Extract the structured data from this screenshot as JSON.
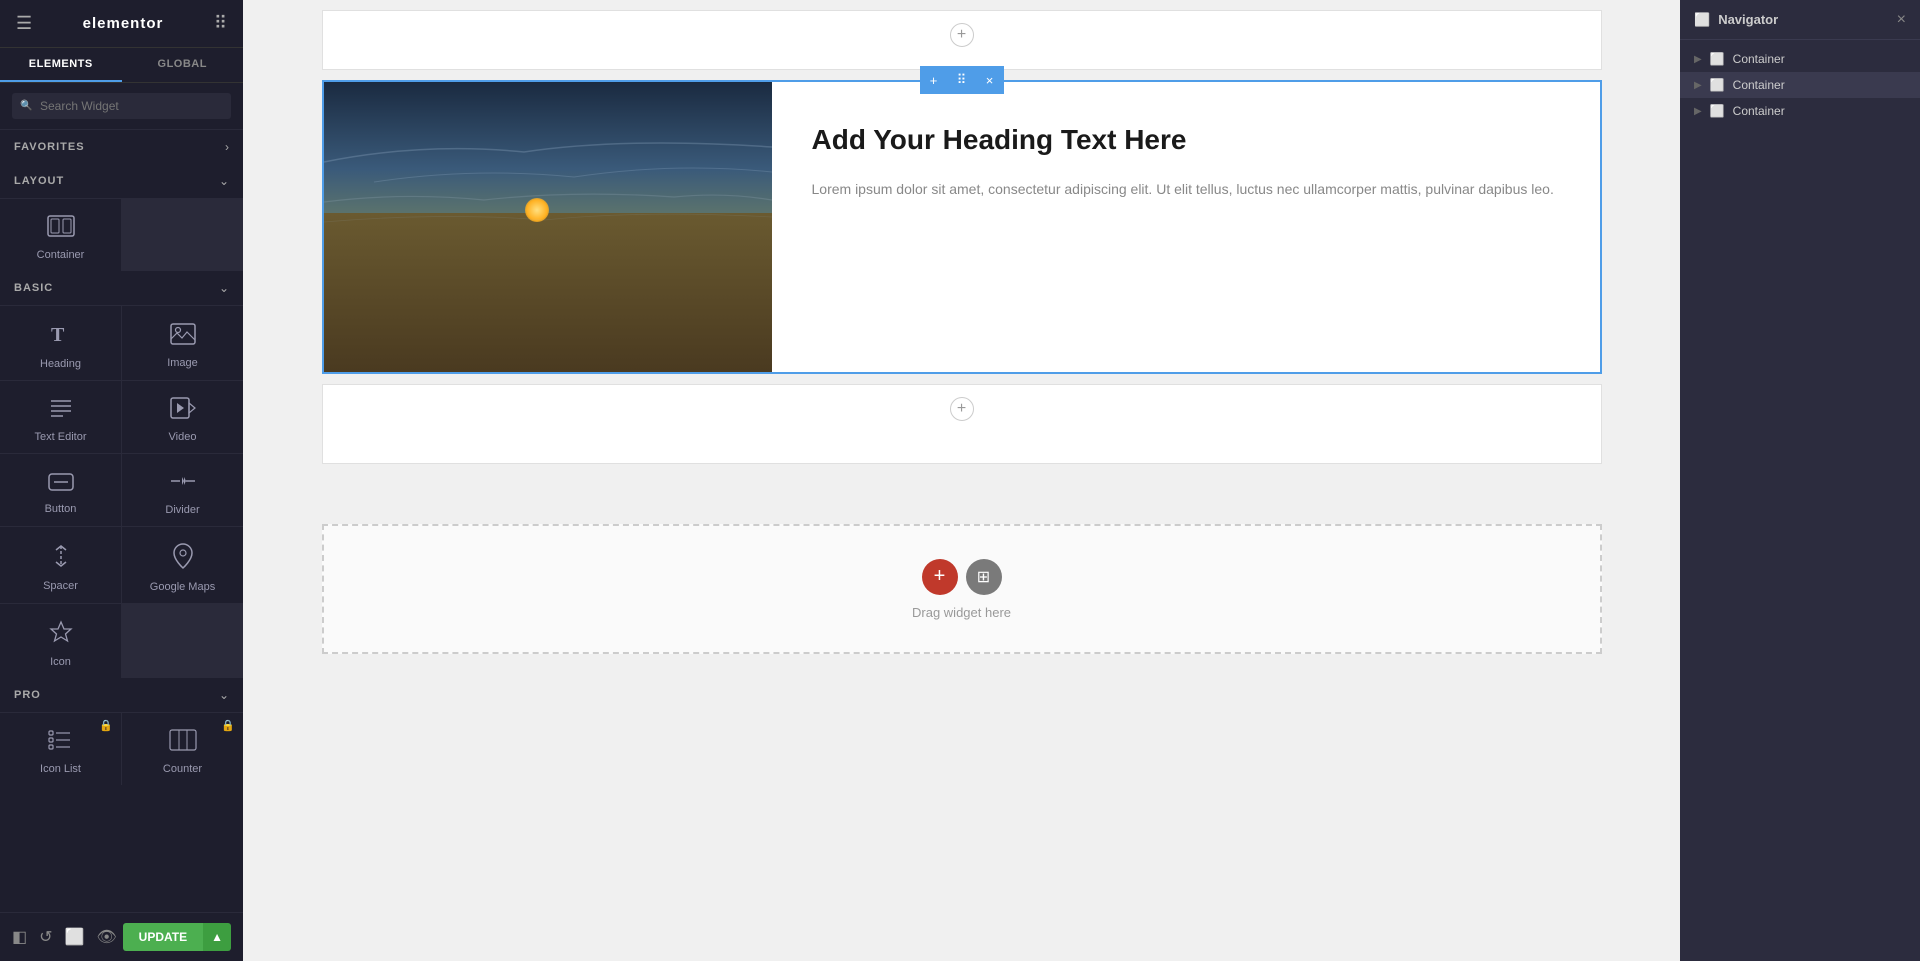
{
  "app": {
    "name": "elementor",
    "title": "Elementor"
  },
  "left_panel": {
    "tabs": [
      {
        "id": "elements",
        "label": "ELEMENTS",
        "active": true
      },
      {
        "id": "global",
        "label": "GLOBAL",
        "active": false
      }
    ],
    "search": {
      "placeholder": "Search Widget"
    },
    "sections": [
      {
        "id": "favorites",
        "label": "FAVORITES",
        "expanded": true,
        "widgets": []
      },
      {
        "id": "layout",
        "label": "LAYOUT",
        "expanded": true,
        "widgets": [
          {
            "id": "container",
            "label": "Container",
            "icon": "container"
          }
        ]
      },
      {
        "id": "basic",
        "label": "BASIC",
        "expanded": true,
        "widgets": [
          {
            "id": "heading",
            "label": "Heading",
            "icon": "heading"
          },
          {
            "id": "image",
            "label": "Image",
            "icon": "image"
          },
          {
            "id": "text-editor",
            "label": "Text Editor",
            "icon": "text-editor"
          },
          {
            "id": "video",
            "label": "Video",
            "icon": "video"
          },
          {
            "id": "button",
            "label": "Button",
            "icon": "button"
          },
          {
            "id": "divider",
            "label": "Divider",
            "icon": "divider"
          },
          {
            "id": "spacer",
            "label": "Spacer",
            "icon": "spacer"
          },
          {
            "id": "google-maps",
            "label": "Google Maps",
            "icon": "google-maps"
          },
          {
            "id": "icon",
            "label": "Icon",
            "icon": "icon"
          }
        ]
      },
      {
        "id": "pro",
        "label": "PRO",
        "expanded": true,
        "widgets": [
          {
            "id": "icon-list",
            "label": "Icon List",
            "icon": "icon-list",
            "locked": true
          },
          {
            "id": "counter",
            "label": "Counter",
            "icon": "counter",
            "locked": true
          }
        ]
      }
    ],
    "footer": {
      "update_label": "UPDATE",
      "update_arrow": "▲"
    }
  },
  "canvas": {
    "sections": [
      {
        "id": "section-1",
        "type": "empty-top"
      },
      {
        "id": "section-2",
        "type": "content",
        "active": true,
        "toolbar": {
          "add": "+",
          "move": "⠿",
          "close": "×"
        },
        "image_alt": "Mountain landscape at sunset",
        "heading": "Add Your Heading Text Here",
        "body_text": "Lorem ipsum dolor sit amet, consectetur adipiscing elit. Ut elit tellus, luctus nec ullamcorper mattis, pulvinar dapibus leo."
      },
      {
        "id": "section-3",
        "type": "empty"
      },
      {
        "id": "section-4",
        "type": "drop-zone",
        "add_btn": "+",
        "template_btn": "⊞",
        "drag_text": "Drag widget here"
      }
    ]
  },
  "navigator": {
    "title": "Navigator",
    "close_btn": "×",
    "items": [
      {
        "id": "container-1",
        "label": "Container",
        "level": 0
      },
      {
        "id": "container-2",
        "label": "Container",
        "level": 0,
        "highlighted": true
      },
      {
        "id": "container-3",
        "label": "Container",
        "level": 0
      }
    ]
  },
  "colors": {
    "accent_blue": "#4f9de8",
    "panel_bg": "#1e1e2d",
    "nav_bg": "#2c2c3e",
    "active_border": "#4f9de8",
    "update_green": "#4caf50",
    "delete_red": "#c0392b"
  }
}
